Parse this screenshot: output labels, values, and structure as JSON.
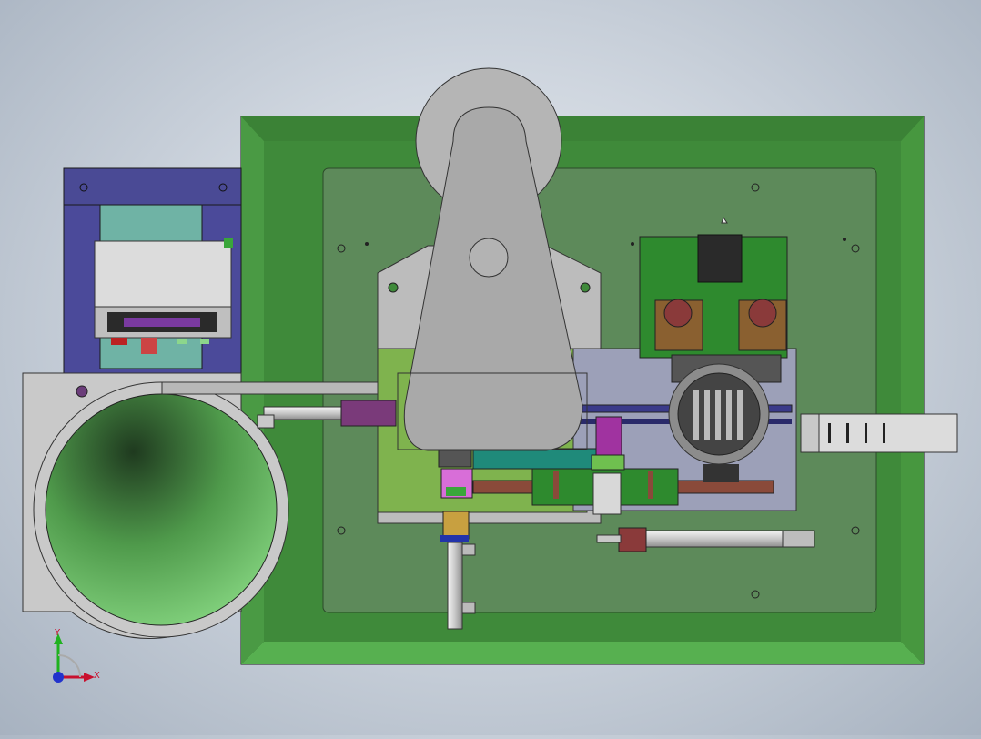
{
  "viewport": {
    "triad": {
      "x_label": "X",
      "y_label": "Y",
      "z_label": ""
    }
  },
  "colors": {
    "tray_green": "#3f8a3a",
    "tray_border": "#2f6e2b",
    "plate_green": "#5d8a5a",
    "bowl_gray": "#c9c9c9",
    "bowl_green": "#7fc87a",
    "cam_gray": "#a9a9a9",
    "motor_gray": "#8c8c8c",
    "frame_blue": "#4b4a9a",
    "feeder_teal": "#6fb3a5",
    "axis_x": "#c8102e",
    "axis_y": "#1fb21f",
    "axis_z": "#2233cc"
  }
}
